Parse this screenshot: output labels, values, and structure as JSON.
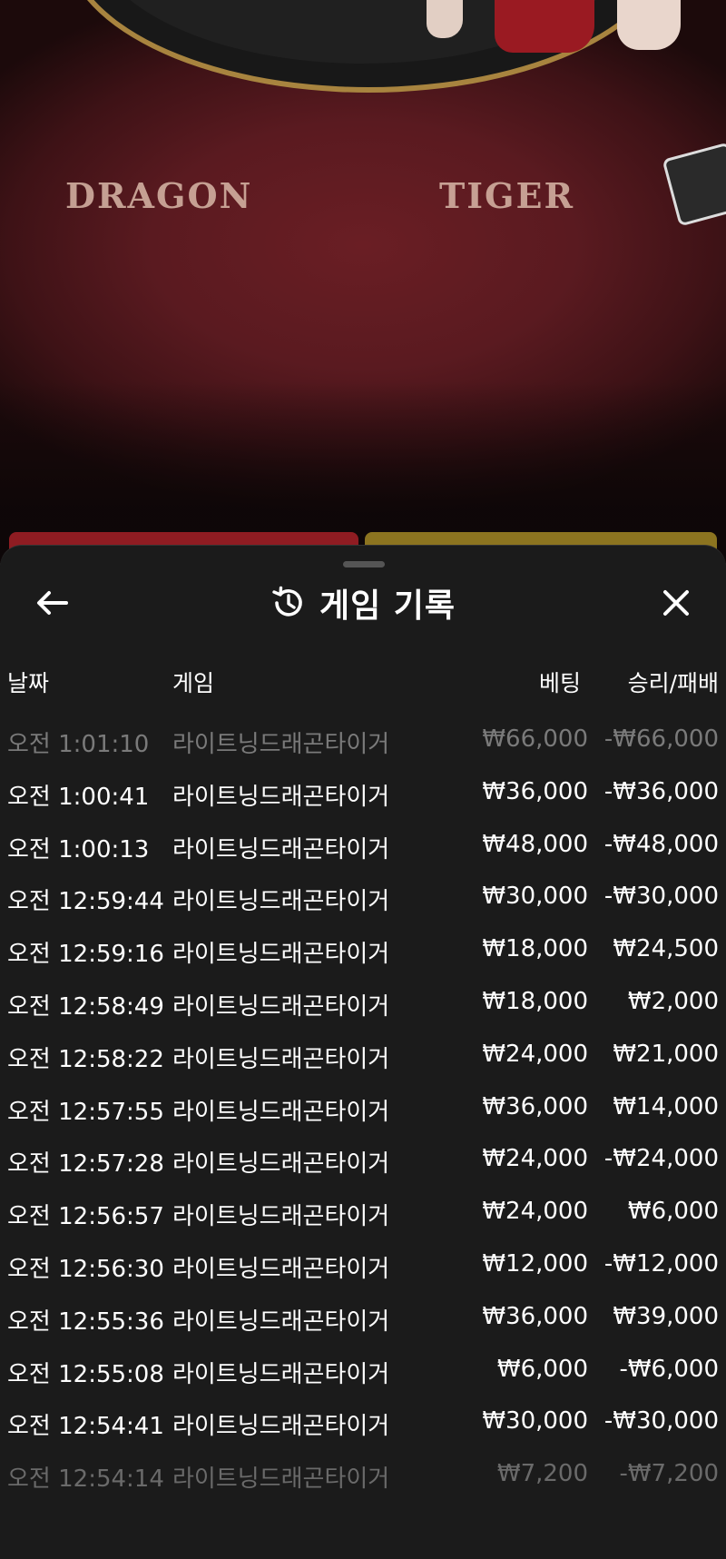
{
  "table": {
    "left_label": "DRAGON",
    "right_label": "TIGER"
  },
  "sheet": {
    "title": "게임 기록",
    "columns": {
      "date": "날짜",
      "game": "게임",
      "bet": "베팅",
      "win_loss": "승리/패배"
    },
    "rows": [
      {
        "date": "오전 1:01:10",
        "game": "라이트닝드래곤타이거",
        "bet": "₩66,000",
        "result": "-₩66,000"
      },
      {
        "date": "오전 1:00:41",
        "game": "라이트닝드래곤타이거",
        "bet": "₩36,000",
        "result": "-₩36,000"
      },
      {
        "date": "오전 1:00:13",
        "game": "라이트닝드래곤타이거",
        "bet": "₩48,000",
        "result": "-₩48,000"
      },
      {
        "date": "오전 12:59:44",
        "game": "라이트닝드래곤타이거",
        "bet": "₩30,000",
        "result": "-₩30,000"
      },
      {
        "date": "오전 12:59:16",
        "game": "라이트닝드래곤타이거",
        "bet": "₩18,000",
        "result": "₩24,500"
      },
      {
        "date": "오전 12:58:49",
        "game": "라이트닝드래곤타이거",
        "bet": "₩18,000",
        "result": "₩2,000"
      },
      {
        "date": "오전 12:58:22",
        "game": "라이트닝드래곤타이거",
        "bet": "₩24,000",
        "result": "₩21,000"
      },
      {
        "date": "오전 12:57:55",
        "game": "라이트닝드래곤타이거",
        "bet": "₩36,000",
        "result": "₩14,000"
      },
      {
        "date": "오전 12:57:28",
        "game": "라이트닝드래곤타이거",
        "bet": "₩24,000",
        "result": "-₩24,000"
      },
      {
        "date": "오전 12:56:57",
        "game": "라이트닝드래곤타이거",
        "bet": "₩24,000",
        "result": "₩6,000"
      },
      {
        "date": "오전 12:56:30",
        "game": "라이트닝드래곤타이거",
        "bet": "₩12,000",
        "result": "-₩12,000"
      },
      {
        "date": "오전 12:55:36",
        "game": "라이트닝드래곤타이거",
        "bet": "₩36,000",
        "result": "₩39,000"
      },
      {
        "date": "오전 12:55:08",
        "game": "라이트닝드래곤타이거",
        "bet": "₩6,000",
        "result": "-₩6,000"
      },
      {
        "date": "오전 12:54:41",
        "game": "라이트닝드래곤타이거",
        "bet": "₩30,000",
        "result": "-₩30,000"
      },
      {
        "date": "오전 12:54:14",
        "game": "라이트닝드래곤타이거",
        "bet": "₩7,200",
        "result": "-₩7,200"
      }
    ]
  },
  "icons": {
    "back": "arrow-left-icon",
    "history": "history-icon",
    "close": "close-icon"
  },
  "colors": {
    "sheet_bg": "#1b1b1b",
    "text": "#ffffff",
    "dim_text": "#7a7a7a",
    "table_red": "#5a1a20",
    "gold": "#a8843f"
  }
}
